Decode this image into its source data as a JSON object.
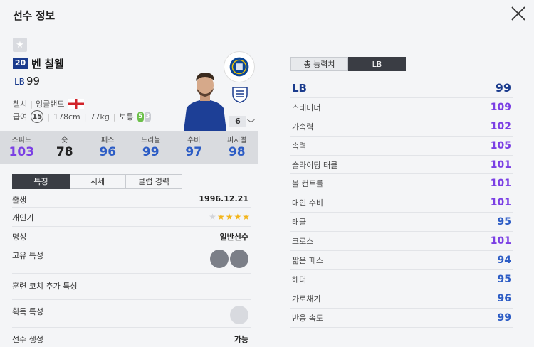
{
  "window": {
    "title": "선수 정보"
  },
  "player": {
    "number": "20",
    "name": "벤 칠웰",
    "position": "LB",
    "overall": "99",
    "club": "첼시",
    "nation": "잉글랜드",
    "pay_label": "급여",
    "pay": "15",
    "height": "178cm",
    "weight": "77kg",
    "body_type": "보통",
    "weak_foot_left": "5",
    "weak_foot_right": "3",
    "upgrade_level": "6"
  },
  "summary_stats": [
    {
      "label": "스피드",
      "value": "103",
      "color": "#7b3fe4"
    },
    {
      "label": "슛",
      "value": "78",
      "color": "#222222"
    },
    {
      "label": "패스",
      "value": "96",
      "color": "#2c5cc5"
    },
    {
      "label": "드리블",
      "value": "99",
      "color": "#2c5cc5"
    },
    {
      "label": "수비",
      "value": "97",
      "color": "#2c5cc5"
    },
    {
      "label": "피지컬",
      "value": "98",
      "color": "#2c5cc5"
    }
  ],
  "tabs": [
    "특징",
    "시세",
    "클럽 경력"
  ],
  "details": {
    "birth_label": "출생",
    "birth": "1996.12.21",
    "popularity_label": "개인기",
    "popularity_stars": 4,
    "fame_label": "명성",
    "fame": "일반선수",
    "unique_traits_label": "고유 특성",
    "coach_traits_label": "훈련 코치 추가 특성",
    "acquired_traits_label": "획득 특성",
    "create_label": "선수 생성",
    "create": "가능"
  },
  "right_tabs": [
    "총 능력치",
    "LB"
  ],
  "attributes_head": {
    "label": "LB",
    "value": "99"
  },
  "attributes": [
    {
      "label": "스태미너",
      "value": "109",
      "color": "#7b3fe4"
    },
    {
      "label": "가속력",
      "value": "102",
      "color": "#7b3fe4"
    },
    {
      "label": "속력",
      "value": "105",
      "color": "#7b3fe4"
    },
    {
      "label": "슬라이딩 태클",
      "value": "101",
      "color": "#7b3fe4"
    },
    {
      "label": "볼 컨트롤",
      "value": "101",
      "color": "#7b3fe4"
    },
    {
      "label": "대인 수비",
      "value": "101",
      "color": "#7b3fe4"
    },
    {
      "label": "태클",
      "value": "95",
      "color": "#2c5cc5"
    },
    {
      "label": "크로스",
      "value": "101",
      "color": "#7b3fe4"
    },
    {
      "label": "짧은 패스",
      "value": "94",
      "color": "#2c5cc5"
    },
    {
      "label": "헤더",
      "value": "95",
      "color": "#2c5cc5"
    },
    {
      "label": "가로채기",
      "value": "96",
      "color": "#2c5cc5"
    },
    {
      "label": "반응 속도",
      "value": "99",
      "color": "#2c5cc5"
    }
  ]
}
